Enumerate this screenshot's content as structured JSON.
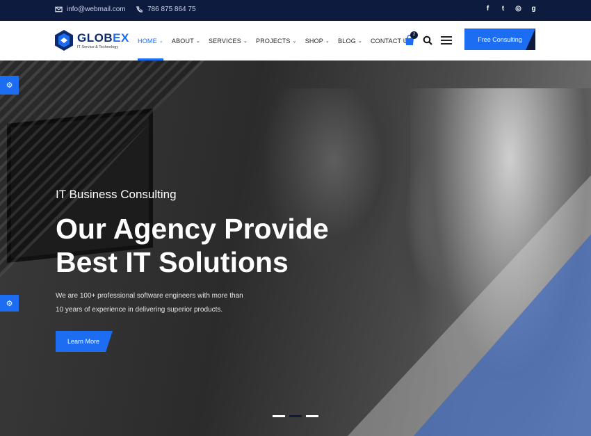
{
  "topbar": {
    "email": "info@webmail.com",
    "phone": "786 875 864 75",
    "social": [
      {
        "icon": "facebook-icon",
        "glyph": "f"
      },
      {
        "icon": "twitter-icon",
        "glyph": "t"
      },
      {
        "icon": "dribbble-icon",
        "glyph": "◎"
      },
      {
        "icon": "google-icon",
        "glyph": "g"
      }
    ]
  },
  "header": {
    "logo_name_a": "GLOB",
    "logo_name_b": "EX",
    "logo_tagline": "IT Service & Technology",
    "nav": [
      {
        "label": "HOME",
        "active": true
      },
      {
        "label": "ABOUT",
        "active": false
      },
      {
        "label": "SERVICES",
        "active": false
      },
      {
        "label": "PROJECTS",
        "active": false
      },
      {
        "label": "SHOP",
        "active": false
      },
      {
        "label": "BLOG",
        "active": false
      },
      {
        "label": "CONTACT US",
        "active": false,
        "no_chevron": true
      }
    ],
    "cart_count": "2",
    "cta_label": "Free Consulting"
  },
  "hero": {
    "subtitle": "IT Business Consulting",
    "title_line1": "Our Agency Provide",
    "title_line2": "Best IT Solutions",
    "desc_line1": "We are 100+ professional software engineers with more than",
    "desc_line2": "10 years of experience in delivering superior products.",
    "button_label": "Learn More",
    "slides": 3,
    "current_slide": 2
  },
  "colors": {
    "primary": "#1d6df2",
    "navy": "#0d1b3e"
  }
}
